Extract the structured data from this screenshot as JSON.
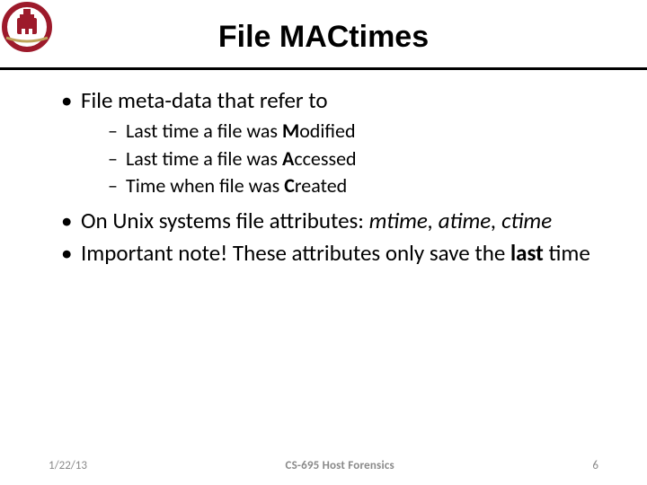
{
  "logo": {
    "bg": "#ffffff",
    "ring": "#9d1a2b",
    "notch": "#bfa45a"
  },
  "title": "File MACtimes",
  "bullets": {
    "b1": {
      "text": "File meta-data that refer to",
      "sub": {
        "s1_pre": "Last time a file was ",
        "s1_b": "M",
        "s1_post": "odified",
        "s2_pre": "Last time a file was ",
        "s2_b": "A",
        "s2_post": "ccessed",
        "s3_pre": "Time when file was ",
        "s3_b": "C",
        "s3_post": "reated"
      }
    },
    "b2": {
      "pre": "On Unix systems file attributes: ",
      "it": "mtime, atime, ctime"
    },
    "b3": {
      "pre": "Important note! These attributes only save the ",
      "b": "last",
      "post": " time"
    }
  },
  "footer": {
    "date": "1/22/13",
    "course": "CS-695 Host Forensics",
    "page": "6"
  }
}
